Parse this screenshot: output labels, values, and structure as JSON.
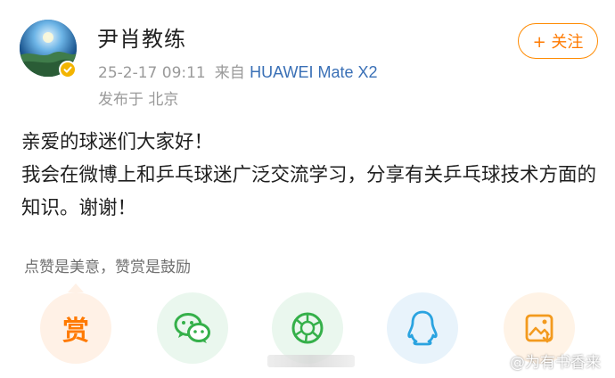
{
  "header": {
    "username": "尹肖教练",
    "date": "25-2-17 09:11",
    "from_label": "来自",
    "device": "HUAWEI Mate X2",
    "location": "发布于 北京",
    "follow_label": "+ 关注"
  },
  "post": {
    "line1": "亲爱的球迷们大家好！",
    "line2": "我会在微博上和乒乓球迷广泛交流学习，分享有关乒乓球技术方面的知识。谢谢！"
  },
  "engagement": {
    "tip_text": "点赞是美意，赞赏是鼓励",
    "reward_label": "赏"
  },
  "share": {
    "items": [
      {
        "icon": "reward-icon"
      },
      {
        "icon": "wechat-icon"
      },
      {
        "icon": "moments-icon"
      },
      {
        "icon": "qq-icon"
      },
      {
        "icon": "save-image-icon"
      }
    ]
  },
  "watermark": {
    "text": "@为有书香来"
  },
  "colors": {
    "accent_orange": "#ff7a00",
    "link_blue": "#3a70b6",
    "verified_gold": "#f3b400",
    "meta_gray": "#9a9a9a"
  }
}
